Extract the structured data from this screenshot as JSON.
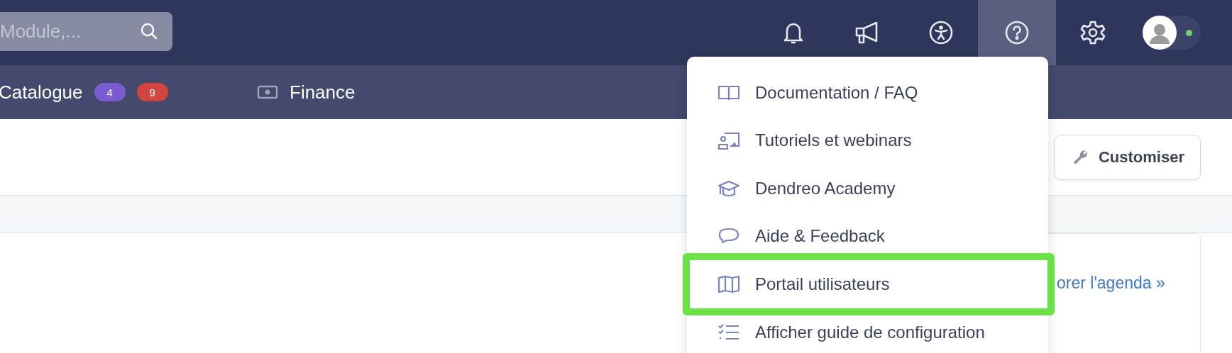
{
  "search": {
    "placeholder": "Module,..."
  },
  "top_icons": [
    {
      "kind": "bell",
      "selected": false
    },
    {
      "kind": "megaphone",
      "selected": false
    },
    {
      "kind": "accessibility",
      "selected": false
    },
    {
      "kind": "help",
      "selected": true
    },
    {
      "kind": "settings",
      "selected": false
    }
  ],
  "user": {
    "online": true
  },
  "nav": [
    {
      "label": "Catalogue",
      "kind": "badges",
      "badges": [
        {
          "text": "4",
          "color": "#7a5bd1"
        },
        {
          "text": "9",
          "color": "#d2453f"
        }
      ]
    },
    {
      "label": "Finance",
      "kind": "money"
    }
  ],
  "customise_button": "Customiser",
  "agenda_link": "orer l'agenda »",
  "help_menu": [
    {
      "label": "Documentation / FAQ",
      "kind": "book",
      "outlined": false
    },
    {
      "label": "Tutoriels et webinars",
      "kind": "presenter",
      "outlined": false
    },
    {
      "label": "Dendreo Academy",
      "kind": "cap",
      "outlined": false
    },
    {
      "label": "Aide & Feedback",
      "kind": "chat",
      "outlined": false
    },
    {
      "label": "Portail utilisateurs",
      "kind": "map",
      "outlined": true
    },
    {
      "label": "Afficher guide de configuration",
      "kind": "checklist",
      "outlined": false
    }
  ]
}
